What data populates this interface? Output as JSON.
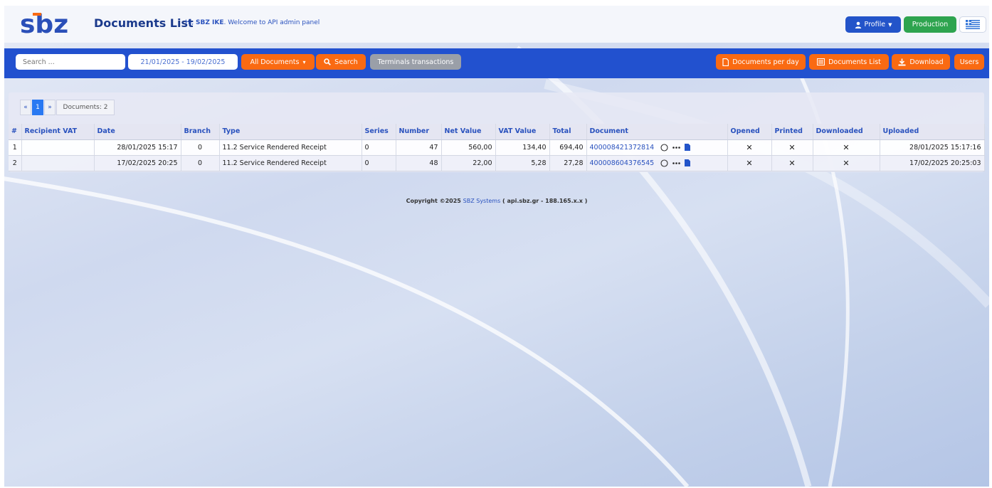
{
  "header": {
    "logo_text": "sbz",
    "title": "Documents List",
    "welcome_prefix": "Hi, ",
    "welcome_user": "SBZ IKE",
    "welcome_suffix": ". Welcome to API admin panel",
    "profile_label": "Profile",
    "production_label": "Production"
  },
  "toolbar": {
    "search_placeholder": "Search ...",
    "date_range": "21/01/2025 - 19/02/2025",
    "all_documents_label": "All Documents",
    "search_label": "Search",
    "terminals_label": "Terminals transactions",
    "per_day_label": "Documents per day",
    "doc_list_label": "Documents List",
    "download_label": "Download",
    "users_label": "Users"
  },
  "pager": {
    "prev": "«",
    "current": "1",
    "next": "»",
    "count_label": "Documents: 2"
  },
  "table": {
    "columns": [
      "#",
      "Recipient VAT",
      "Date",
      "Branch",
      "Type",
      "Series",
      "Number",
      "Net Value",
      "VAT Value",
      "Total",
      "Document",
      "Opened",
      "Printed",
      "Downloaded",
      "Uploaded"
    ],
    "rows": [
      {
        "idx": "1",
        "recipient_vat": "",
        "date": "28/01/2025 15:17",
        "branch": "0",
        "type": "11.2 Service Rendered Receipt",
        "series": "0",
        "number": "47",
        "net": "560,00",
        "vat": "134,40",
        "total": "694,40",
        "document": "400008421372814",
        "opened": "✕",
        "printed": "✕",
        "downloaded": "✕",
        "uploaded": "28/01/2025 15:17:16"
      },
      {
        "idx": "2",
        "recipient_vat": "",
        "date": "17/02/2025 20:25",
        "branch": "0",
        "type": "11.2 Service Rendered Receipt",
        "series": "0",
        "number": "48",
        "net": "22,00",
        "vat": "5,28",
        "total": "27,28",
        "document": "400008604376545",
        "opened": "✕",
        "printed": "✕",
        "downloaded": "✕",
        "uploaded": "17/02/2025 20:25:03"
      }
    ]
  },
  "footer": {
    "copyright": "Copyright ©2025 ",
    "company": "SBZ Systems",
    "suffix": " ( api.sbz.gr - 188.165.x.x )"
  },
  "colors": {
    "brand_blue": "#2251cf",
    "accent_orange": "#fa6a12",
    "production_green": "#2ea44f",
    "status_red": "#e23a3a"
  }
}
